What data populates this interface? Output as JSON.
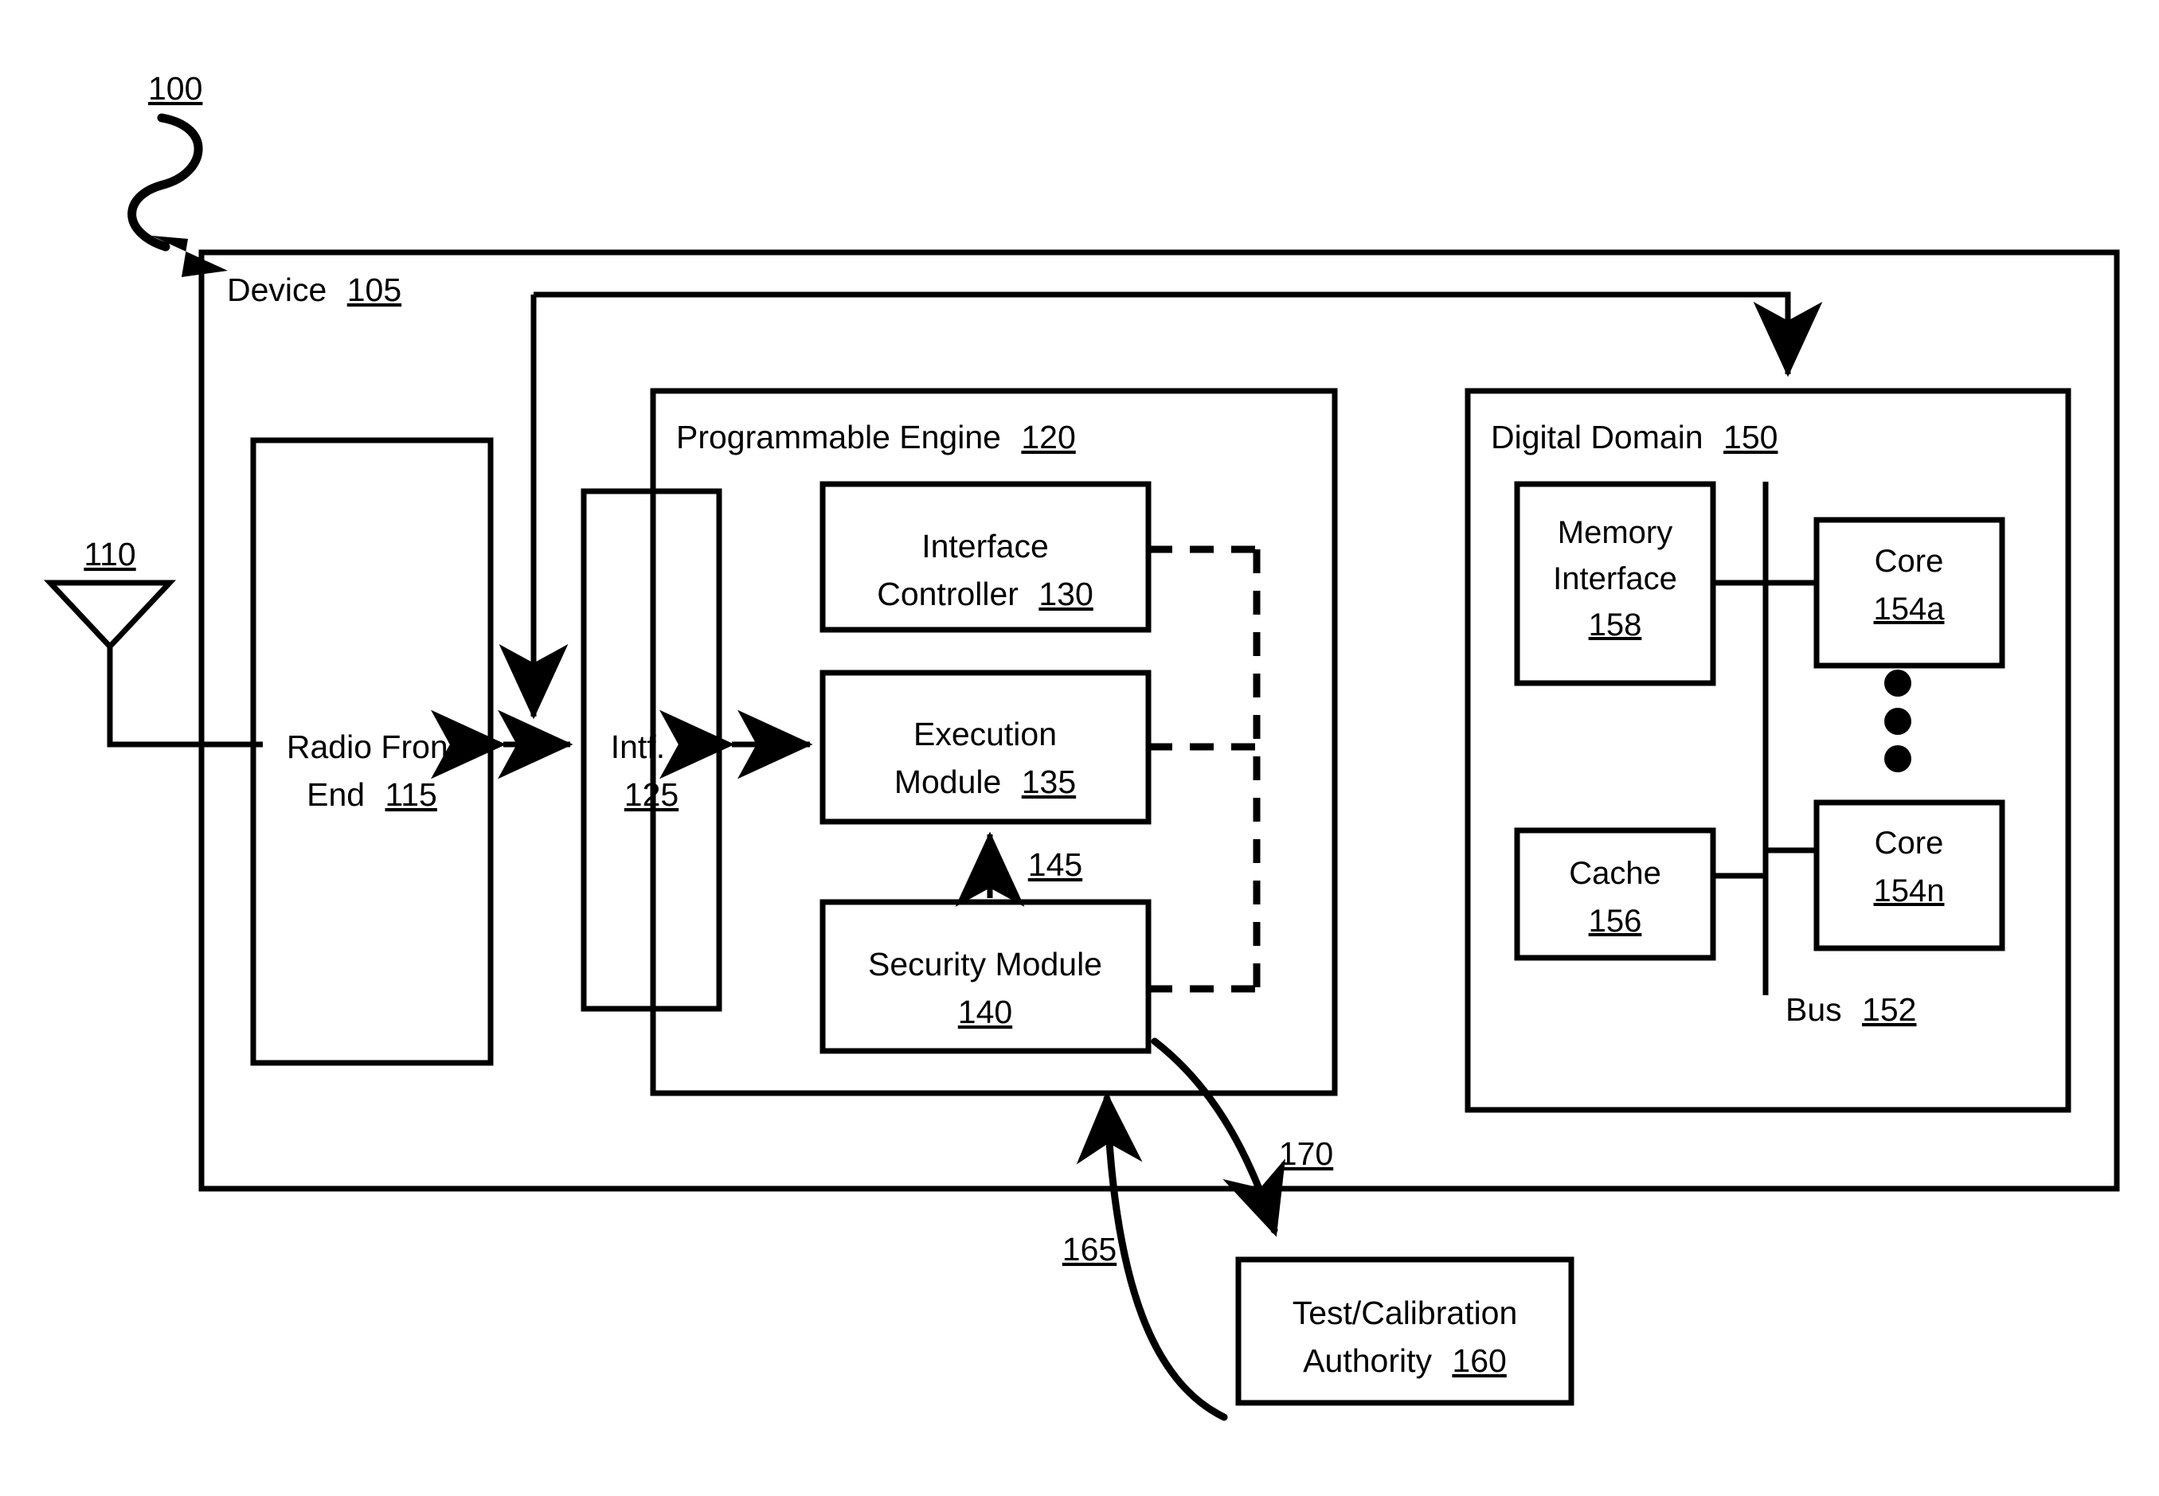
{
  "figure": {
    "ref_label": "100",
    "device": {
      "name": "Device",
      "ref": "105"
    },
    "antenna": {
      "ref": "110"
    },
    "radio_front_end": {
      "line1": "Radio Front",
      "line2": "End",
      "ref": "115"
    },
    "programmable_engine": {
      "name": "Programmable Engine",
      "ref": "120"
    },
    "interface1": {
      "line1": "Intf. 1",
      "ref": "125"
    },
    "interface_controller": {
      "line1": "Interface",
      "line2": "Controller",
      "ref": "130"
    },
    "execution_module": {
      "line1": "Execution",
      "line2": "Module",
      "ref": "135"
    },
    "security_module": {
      "line1": "Security Module",
      "ref": "140"
    },
    "link_145": {
      "ref": "145"
    },
    "digital_domain": {
      "name": "Digital Domain",
      "ref": "150"
    },
    "bus": {
      "name": "Bus",
      "ref": "152"
    },
    "core_a": {
      "name": "Core",
      "ref": "154a"
    },
    "core_n": {
      "name": "Core",
      "ref": "154n"
    },
    "cache": {
      "name": "Cache",
      "ref": "156"
    },
    "memory_interface": {
      "line1": "Memory",
      "line2": "Interface",
      "ref": "158"
    },
    "test_calibration_authority": {
      "line1": "Test/Calibration",
      "line2": "Authority",
      "ref": "160"
    },
    "arrow_165": {
      "ref": "165"
    },
    "arrow_170": {
      "ref": "170"
    },
    "colors": {
      "stroke": "#000000",
      "background": "#ffffff"
    }
  }
}
